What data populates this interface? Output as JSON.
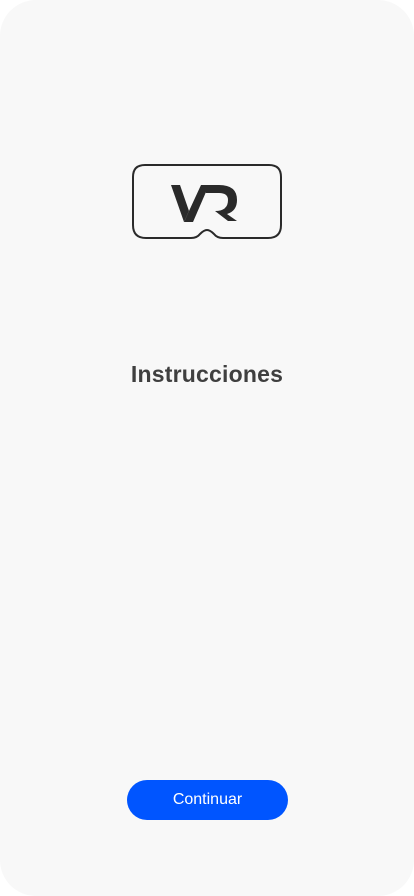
{
  "logo": {
    "icon": "vr-headset-icon",
    "text": "VR"
  },
  "main": {
    "title": "Instrucciones"
  },
  "footer": {
    "continue_label": "Continuar"
  },
  "colors": {
    "background": "#f8f8f8",
    "title": "#3f3f3f",
    "accent": "#0055ff",
    "button_text": "#ffffff"
  }
}
